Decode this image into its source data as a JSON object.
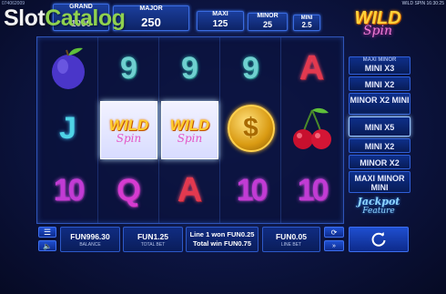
{
  "header": {
    "session_id": "074062009",
    "session_title": "WILD SPIN 16:30:25",
    "watermark_main": "Slot",
    "watermark_accent": "Catalog"
  },
  "jackpots": [
    {
      "name": "GRAND",
      "value": "1000"
    },
    {
      "name": "MAJOR",
      "value": "250"
    },
    {
      "name": "MAXI",
      "value": "125"
    },
    {
      "name": "MINOR",
      "value": "25"
    },
    {
      "name": "MINI",
      "value": "2.5"
    }
  ],
  "logo": {
    "line1": "WILD",
    "line2": "Spin"
  },
  "reels": [
    [
      "plum",
      "J",
      "10"
    ],
    [
      "9",
      "WILD",
      "Q"
    ],
    [
      "9",
      "WILD",
      "A"
    ],
    [
      "9",
      "$",
      "10"
    ],
    [
      "A",
      "cherries",
      "10"
    ]
  ],
  "wild": {
    "line1": "WILD",
    "line2": "Spin"
  },
  "meters": [
    {
      "small": "MAXI MINOR",
      "big": "MINI X3"
    },
    {
      "small": "",
      "big": "MINI X2"
    },
    {
      "small": "",
      "big": "MINOR X2 MINI"
    },
    {
      "small": "",
      "big": "MINI X5"
    },
    {
      "small": "",
      "big": "MINI X2"
    },
    {
      "small": "",
      "big": "MINOR X2"
    },
    {
      "small": "",
      "big": "MAXI MINOR MINI"
    }
  ],
  "jackpot_feature": {
    "line1": "Jackpot",
    "line2": "Feature"
  },
  "bottom": {
    "balance_value": "FUN996.30",
    "balance_label": "BALANCE",
    "total_bet_value": "FUN1.25",
    "total_bet_label": "TOTAL BET",
    "message_line1": "Line 1 won FUN0.25",
    "message_line2": "Total win FUN0.75",
    "line_bet_value": "FUN0.05",
    "line_bet_label": "LINE BET"
  },
  "icons": {
    "menu": "menu-icon",
    "sound": "speaker-icon",
    "autoplay": "autoplay-icon",
    "turbo": "fast-forward-icon",
    "spin": "spin-icon"
  },
  "colors": {
    "accent": "#2f5fd8",
    "wild_gold": "#ffcf2f",
    "spin_pink": "#e454c6"
  }
}
